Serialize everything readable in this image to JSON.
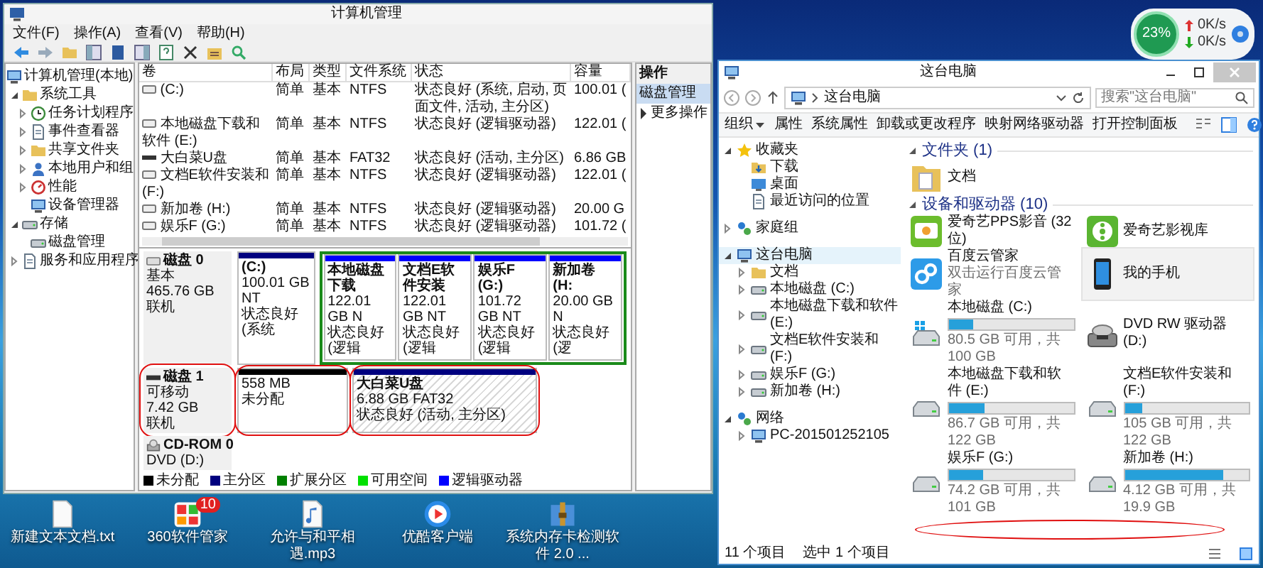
{
  "desktop_widget": {
    "percent": "23%",
    "upload": "0K/s",
    "download": "0K/s"
  },
  "desktop_icons": [
    {
      "kind": "text-file",
      "label": "新建文本文档.txt"
    },
    {
      "kind": "app-store",
      "label": "360软件管家",
      "badge": "10"
    },
    {
      "kind": "mp3",
      "label": "允许与和平相遇.mp3"
    },
    {
      "kind": "video-player",
      "label": "优酷客户端"
    },
    {
      "kind": "archive",
      "label": "系统内存卡检测软件 2.0 ..."
    }
  ],
  "computer_management": {
    "title": "计算机管理",
    "menu": [
      "文件(F)",
      "操作(A)",
      "查看(V)",
      "帮助(H)"
    ],
    "tree": [
      {
        "label": "计算机管理(本地)",
        "kind": "computer",
        "children": [
          {
            "label": "系统工具",
            "kind": "folder",
            "expanded": true,
            "children": [
              {
                "label": "任务计划程序",
                "kind": "clock",
                "expanded": false
              },
              {
                "label": "事件查看器",
                "kind": "doc",
                "expanded": false
              },
              {
                "label": "共享文件夹",
                "kind": "folder",
                "expanded": false
              },
              {
                "label": "本地用户和组",
                "kind": "user",
                "expanded": false
              },
              {
                "label": "性能",
                "kind": "gauge",
                "expanded": false
              },
              {
                "label": "设备管理器",
                "kind": "computer"
              }
            ]
          },
          {
            "label": "存储",
            "kind": "disk",
            "expanded": true,
            "children": [
              {
                "label": "磁盘管理",
                "kind": "disk"
              }
            ]
          },
          {
            "label": "服务和应用程序",
            "kind": "doc",
            "expanded": false
          }
        ]
      }
    ],
    "volumes": {
      "columns": [
        "卷",
        "布局",
        "类型",
        "文件系统",
        "状态",
        "容量"
      ],
      "rows": [
        {
          "kind": "drive",
          "cells": [
            "(C:)",
            "简单",
            "基本",
            "NTFS",
            "状态良好 (系统, 启动, 页面文件, 活动, 主分区)",
            "100.01 ("
          ]
        },
        {
          "kind": "drive",
          "cells": [
            "本地磁盘下载和软件 (E:)",
            "简单",
            "基本",
            "NTFS",
            "状态良好 (逻辑驱动器)",
            "122.01 ("
          ]
        },
        {
          "kind": "usb",
          "cells": [
            "大白菜U盘",
            "简单",
            "基本",
            "FAT32",
            "状态良好 (活动, 主分区)",
            "6.86 GB"
          ]
        },
        {
          "kind": "drive",
          "cells": [
            "文档E软件安装和 (F:)",
            "简单",
            "基本",
            "NTFS",
            "状态良好 (逻辑驱动器)",
            "122.01 ("
          ]
        },
        {
          "kind": "drive",
          "cells": [
            "新加卷 (H:)",
            "简单",
            "基本",
            "NTFS",
            "状态良好 (逻辑驱动器)",
            "20.00 G"
          ]
        },
        {
          "kind": "drive",
          "cells": [
            "娱乐F (G:)",
            "简单",
            "基本",
            "NTFS",
            "状态良好 (逻辑驱动器)",
            "101.72 ("
          ]
        }
      ]
    },
    "disks": [
      {
        "kind": "disk",
        "name": "磁盘 0",
        "type": "基本",
        "size": "465.76 GB",
        "status": "联机",
        "annotated": false,
        "partitions": [
          {
            "kind": "primary",
            "name": "(C:)",
            "size": "100.01 GB NT",
            "status": "状态良好 (系统",
            "selected": false,
            "annotated": false
          },
          {
            "kind": "extended",
            "children": [
              {
                "kind": "logical",
                "name": "本地磁盘下载",
                "size": "122.01 GB N",
                "status": "状态良好 (逻辑",
                "selected": false,
                "annotated": false
              },
              {
                "kind": "logical",
                "name": "文档E软件安装",
                "size": "122.01 GB NT",
                "status": "状态良好 (逻辑",
                "selected": false,
                "annotated": false
              },
              {
                "kind": "logical",
                "name": "娱乐F (G:)",
                "size": "101.72 GB NT",
                "status": "状态良好 (逻辑",
                "selected": false,
                "annotated": false
              },
              {
                "kind": "logical",
                "name": "新加卷 (H:",
                "size": "20.00 GB N",
                "status": "状态良好 (逻",
                "selected": false,
                "annotated": false
              }
            ]
          }
        ]
      },
      {
        "kind": "removable",
        "name": "磁盘 1",
        "type": "可移动",
        "size": "7.42 GB",
        "status": "联机",
        "annotated": true,
        "partitions": [
          {
            "kind": "unallocated",
            "size": "558 MB",
            "status": "未分配",
            "selected": false,
            "annotated": true
          },
          {
            "kind": "primary",
            "name": "大白菜U盘",
            "size": "6.88 GB FAT32",
            "status": "状态良好 (活动, 主分区)",
            "selected": true,
            "annotated": true
          }
        ]
      },
      {
        "kind": "cdrom",
        "name": "CD-ROM 0",
        "type": "DVD (D:)",
        "annotated": false
      }
    ],
    "legend": [
      {
        "label": "未分配",
        "color": "#000000"
      },
      {
        "label": "主分区",
        "color": "#00007f"
      },
      {
        "label": "扩展分区",
        "color": "#008000"
      },
      {
        "label": "可用空间",
        "color": "#00e000"
      },
      {
        "label": "逻辑驱动器",
        "color": "#0000ff"
      }
    ],
    "actions": {
      "header": "操作",
      "items": [
        {
          "label": "磁盘管理",
          "selected": true
        },
        {
          "label": "更多操作",
          "selected": false
        }
      ]
    }
  },
  "explorer": {
    "title": "这台电脑",
    "address": "这台电脑",
    "search_placeholder": "搜索\"这台电脑\"",
    "ribbon": [
      {
        "label": "组织",
        "dropdown": true
      },
      {
        "label": "属性",
        "dropdown": false
      },
      {
        "label": "系统属性",
        "dropdown": false
      },
      {
        "label": "卸载或更改程序",
        "dropdown": false
      },
      {
        "label": "映射网络驱动器",
        "dropdown": false
      },
      {
        "label": "打开控制面板",
        "dropdown": false
      }
    ],
    "nav": [
      {
        "label": "收藏夹",
        "kind": "star",
        "expanded": true,
        "selected": false,
        "children": [
          {
            "label": "下载",
            "kind": "download",
            "selected": false
          },
          {
            "label": "桌面",
            "kind": "monitor",
            "selected": false
          },
          {
            "label": "最近访问的位置",
            "kind": "doc",
            "selected": false
          }
        ]
      },
      {
        "label": "家庭组",
        "kind": "network",
        "expanded": false,
        "selected": false
      },
      {
        "label": "这台电脑",
        "kind": "computer",
        "expanded": true,
        "selected": true,
        "children": [
          {
            "label": "文档",
            "kind": "folder",
            "expanded": false,
            "selected": false
          },
          {
            "label": "本地磁盘 (C:)",
            "kind": "disk",
            "expanded": false,
            "selected": false
          },
          {
            "label": "本地磁盘下载和软件 (E:)",
            "kind": "disk",
            "expanded": false,
            "selected": false
          },
          {
            "label": "文档E软件安装和 (F:)",
            "kind": "disk",
            "expanded": false,
            "selected": false
          },
          {
            "label": "娱乐F (G:)",
            "kind": "disk",
            "expanded": false,
            "selected": false
          },
          {
            "label": "新加卷 (H:)",
            "kind": "disk",
            "expanded": false,
            "selected": false
          }
        ]
      },
      {
        "label": "网络",
        "kind": "network",
        "expanded": true,
        "selected": false,
        "children": [
          {
            "label": "PC-201501252105",
            "kind": "computer",
            "expanded": false,
            "selected": false
          }
        ]
      }
    ],
    "groups": [
      {
        "title": "文件夹 (1)",
        "items": [
          {
            "kind": "folder",
            "name": "文档",
            "selected": false
          }
        ]
      },
      {
        "title": "设备和驱动器 (10)",
        "items": [
          {
            "kind": "tv-app",
            "name": "爱奇艺PPS影音 (32 位)",
            "selected": false
          },
          {
            "kind": "film-app",
            "name": "爱奇艺影视库",
            "selected": false
          },
          {
            "kind": "cloud-app",
            "name": "百度云管家",
            "subtitle": "双击运行百度云管家",
            "selected": false
          },
          {
            "kind": "phone",
            "name": "我的手机",
            "selected": true
          },
          {
            "kind": "drive",
            "system": true,
            "name": "本地磁盘 (C:)",
            "level": 0.195,
            "free": "80.5 GB 可用，共 100 GB",
            "selected": false
          },
          {
            "kind": "dvd",
            "name": "DVD RW 驱动器 (D:)",
            "selected": false
          },
          {
            "kind": "drive",
            "system": false,
            "name": "本地磁盘下载和软件 (E:)",
            "level": 0.29,
            "free": "86.7 GB 可用，共 122 GB",
            "selected": false
          },
          {
            "kind": "drive",
            "system": false,
            "name": "文档E软件安装和 (F:)",
            "level": 0.14,
            "free": "105 GB 可用，共 122 GB",
            "selected": false
          },
          {
            "kind": "drive",
            "system": false,
            "name": "娱乐F (G:)",
            "level": 0.27,
            "free": "74.2 GB 可用，共 101 GB",
            "selected": false
          },
          {
            "kind": "drive",
            "system": false,
            "name": "新加卷 (H:)",
            "level": 0.79,
            "free": "4.12 GB 可用，共 19.9 GB",
            "selected": false
          }
        ]
      }
    ],
    "status": [
      "11 个项目",
      "选中 1 个项目"
    ]
  }
}
